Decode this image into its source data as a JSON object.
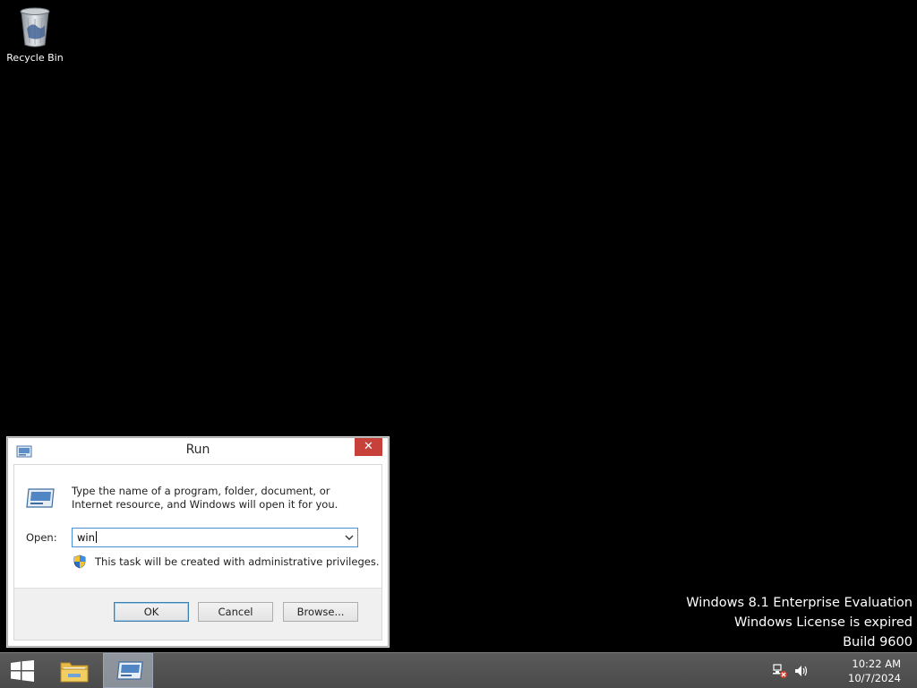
{
  "desktop": {
    "icons": [
      {
        "label": "Recycle Bin",
        "icon": "recycle-bin-icon"
      }
    ],
    "watermark": {
      "line1": "Windows 8.1 Enterprise Evaluation",
      "line2": "Windows License is expired",
      "line3": "Build 9600"
    }
  },
  "run_dialog": {
    "title": "Run",
    "close_label": "✕",
    "description": "Type the name of a program, folder, document, or Internet resource, and Windows will open it for you.",
    "open_label": "Open:",
    "open_value": "win",
    "admin_note": "This task will be created with administrative privileges.",
    "buttons": {
      "ok": "OK",
      "cancel": "Cancel",
      "browse": "Browse..."
    }
  },
  "taskbar": {
    "items": [
      {
        "name": "start",
        "icon": "windows-logo-icon"
      },
      {
        "name": "file-explorer",
        "icon": "folder-icon"
      },
      {
        "name": "run",
        "icon": "run-icon",
        "active": true
      }
    ],
    "tray": {
      "network_icon": "network-disconnected-icon",
      "volume_icon": "volume-icon"
    },
    "clock": {
      "time": "10:22 AM",
      "date": "10/7/2024"
    }
  },
  "colors": {
    "desktop_bg": "#000000",
    "close_button": "#c7413a",
    "focus_border": "#4a90d9",
    "taskbar_bg": "#4f4f4f"
  }
}
